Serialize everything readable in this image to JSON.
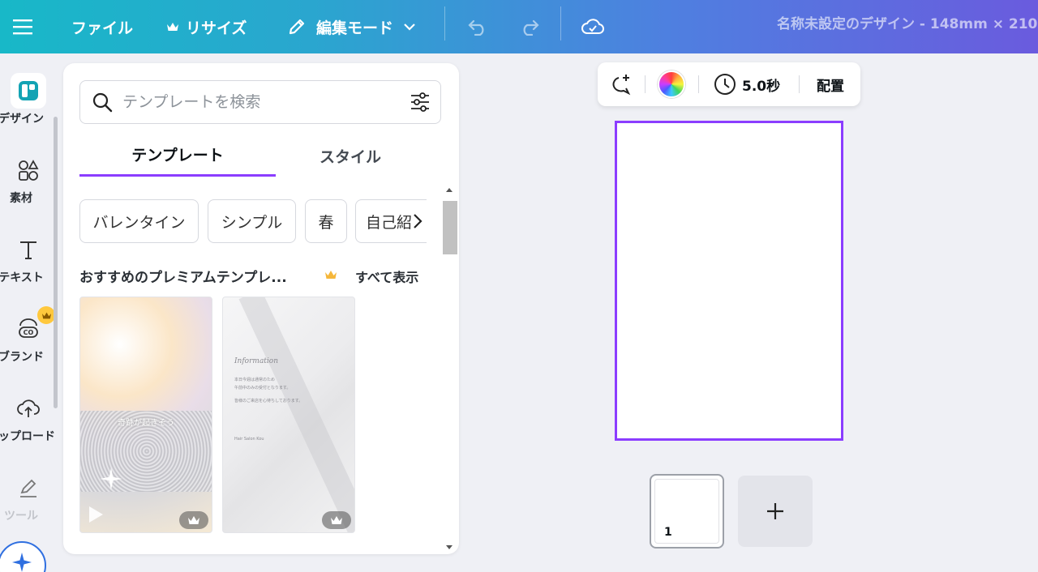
{
  "topbar": {
    "menu_icon": "hamburger-icon",
    "file_label": "ファイル",
    "resize_label": "リサイズ",
    "edit_mode_label": "編集モード",
    "doc_title": "名称未設定のデザイン - 148mm × 210"
  },
  "rail": {
    "items": [
      {
        "label": "デザイン",
        "icon": "design-icon"
      },
      {
        "label": "素材",
        "icon": "elements-icon"
      },
      {
        "label": "テキスト",
        "icon": "text-icon"
      },
      {
        "label": "ブランド",
        "icon": "brand-icon"
      },
      {
        "label": "アップロード",
        "icon": "upload-icon"
      },
      {
        "label": "ツール",
        "icon": "tools-icon"
      }
    ]
  },
  "panel": {
    "search_placeholder": "テンプレートを検索",
    "tabs": [
      "テンプレート",
      "スタイル"
    ],
    "chips": [
      "バレンタイン",
      "シンプル",
      "春",
      "自己紹"
    ],
    "section_title": "おすすめのプレミアムテンプレ...",
    "see_all": "すべて表示",
    "cards": [
      {
        "text": "奇跡が起きそう"
      },
      {
        "title": "Information",
        "lines": [
          "本日今週は通常のため",
          "午前中のみの受付となります。",
          "皆様のご来店を心待ちしております。"
        ],
        "footer": "Hair Salon Kou"
      }
    ]
  },
  "toolbar": {
    "duration": "5.0秒",
    "arrange": "配置"
  },
  "pages": {
    "current_number": "1"
  },
  "colors": {
    "accent": "#8b3dff",
    "teal": "#18b8c8",
    "gradient_end": "#6a5bde"
  }
}
